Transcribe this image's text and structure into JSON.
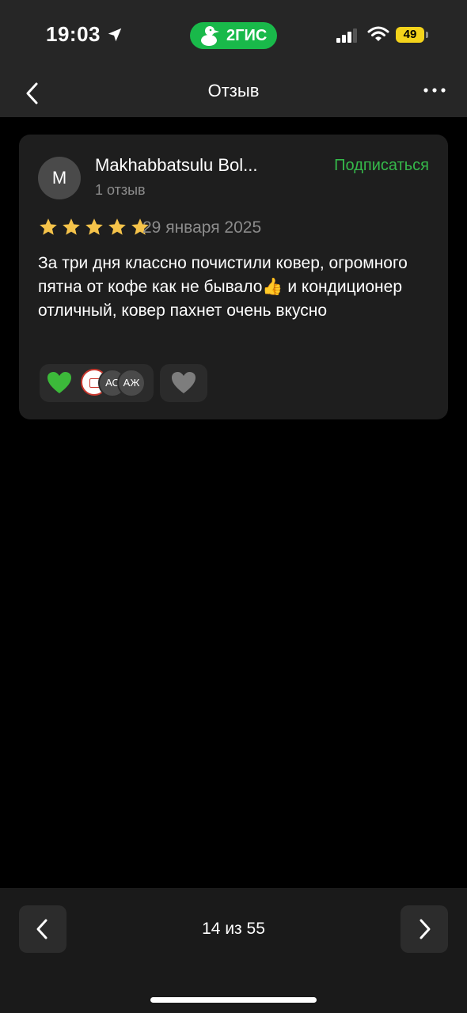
{
  "status_bar": {
    "time": "19:03",
    "app_badge": "2ГИС",
    "battery": "49",
    "icons": [
      "location-arrow-icon",
      "signal-icon",
      "wifi-icon",
      "battery-icon"
    ]
  },
  "nav": {
    "title": "Отзыв",
    "back_icon": "chevron-left-icon",
    "more_icon": "more-dots-icon"
  },
  "review": {
    "avatar_letter": "M",
    "author": "Makhabbatsulu Bol...",
    "review_count": "1 отзыв",
    "subscribe_label": "Подписаться",
    "rating": 5,
    "rating_max": 5,
    "date": "29 января 2025",
    "text": "За три дня классно почистили ковер, огромного пятна от кофе как не бывало👍 и кондиционер отличный, ковер пахнет очень вкусно",
    "reactions": {
      "emoji": "💚",
      "avatars": [
        "",
        "АС",
        "АЖ"
      ]
    },
    "like_icon": "heart-icon"
  },
  "pagination": {
    "label": "14 из 55",
    "prev_icon": "chevron-left-icon",
    "next_icon": "chevron-right-icon"
  },
  "colors": {
    "accent_green": "#35b84a",
    "badge_green": "#19b94a",
    "star": "#f5c34a",
    "card_bg": "#1e1e1e",
    "bar_bg": "#262626"
  }
}
